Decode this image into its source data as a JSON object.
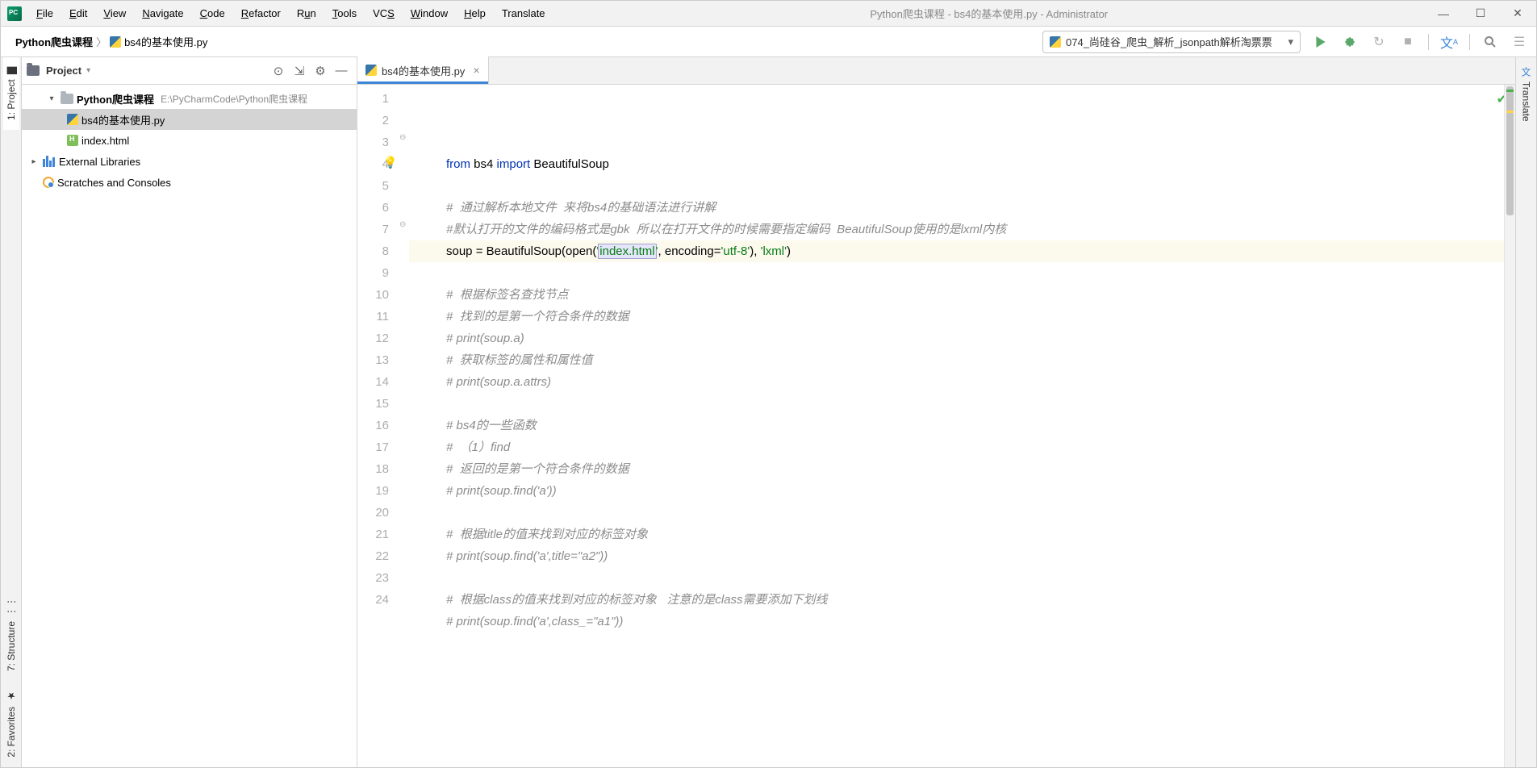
{
  "title": "Python爬虫课程 - bs4的基本使用.py - Administrator",
  "menu": [
    "File",
    "Edit",
    "View",
    "Navigate",
    "Code",
    "Refactor",
    "Run",
    "Tools",
    "VCS",
    "Window",
    "Help",
    "Translate"
  ],
  "breadcrumb": {
    "project": "Python爬虫课程",
    "file": "bs4的基本使用.py"
  },
  "run_config_label": "074_尚硅谷_爬虫_解析_jsonpath解析淘票票",
  "project_panel_title": "Project",
  "tree": {
    "root": {
      "name": "Python爬虫课程",
      "path": "E:\\PyCharmCode\\Python爬虫课程"
    },
    "files": [
      {
        "name": "bs4的基本使用.py",
        "type": "py",
        "selected": true
      },
      {
        "name": "index.html",
        "type": "html",
        "selected": false
      }
    ],
    "external": "External Libraries",
    "scratches": "Scratches and Consoles"
  },
  "left_tabs": {
    "project": "1: Project",
    "structure": "7: Structure",
    "favorites": "2: Favorites"
  },
  "right_tabs": {
    "translate": "Translate"
  },
  "editor_tab": "bs4的基本使用.py",
  "code_lines": [
    {
      "n": 1,
      "type": "code",
      "tokens": [
        [
          "kw",
          "from"
        ],
        [
          "",
          " bs4 "
        ],
        [
          "kw",
          "import"
        ],
        [
          "",
          " BeautifulSoup"
        ]
      ]
    },
    {
      "n": 2,
      "type": "blank"
    },
    {
      "n": 3,
      "type": "cmt",
      "text": "#  通过解析本地文件  来将bs4的基础语法进行讲解"
    },
    {
      "n": 4,
      "type": "cmt",
      "text": "#默认打开的文件的编码格式是gbk  所以在打开文件的时候需要指定编码  BeautifulSoup使用的是lxml内核"
    },
    {
      "n": 5,
      "type": "code",
      "current": true,
      "tokens": [
        [
          "",
          "soup = BeautifulSoup(open("
        ],
        [
          "str",
          "'"
        ],
        [
          "sel",
          "index.html"
        ],
        [
          "str",
          "'"
        ],
        [
          "",
          ", encoding="
        ],
        [
          "str",
          "'utf-8'"
        ],
        [
          "",
          ")"
        ],
        [
          "",
          ", "
        ],
        [
          "str",
          "'lxml'"
        ],
        [
          "",
          ")"
        ]
      ]
    },
    {
      "n": 6,
      "type": "blank"
    },
    {
      "n": 7,
      "type": "cmt",
      "text": "#  根据标签名查找节点"
    },
    {
      "n": 8,
      "type": "cmt",
      "text": "#  找到的是第一个符合条件的数据"
    },
    {
      "n": 9,
      "type": "cmt",
      "text": "# print(soup.a)"
    },
    {
      "n": 10,
      "type": "cmt",
      "text": "#  获取标签的属性和属性值"
    },
    {
      "n": 11,
      "type": "cmt",
      "text": "# print(soup.a.attrs)"
    },
    {
      "n": 12,
      "type": "blank"
    },
    {
      "n": 13,
      "type": "cmt",
      "text": "# bs4的一些函数"
    },
    {
      "n": 14,
      "type": "cmt",
      "text": "#  （1）find"
    },
    {
      "n": 15,
      "type": "cmt",
      "text": "#  返回的是第一个符合条件的数据"
    },
    {
      "n": 16,
      "type": "cmt",
      "text": "# print(soup.find('a'))"
    },
    {
      "n": 17,
      "type": "blank"
    },
    {
      "n": 18,
      "type": "cmt",
      "text": "#  根据title的值来找到对应的标签对象"
    },
    {
      "n": 19,
      "type": "cmt",
      "text": "# print(soup.find('a',title=\"a2\"))"
    },
    {
      "n": 20,
      "type": "blank"
    },
    {
      "n": 21,
      "type": "cmt",
      "text": "#  根据class的值来找到对应的标签对象   注意的是class需要添加下划线"
    },
    {
      "n": 22,
      "type": "cmt",
      "text": "# print(soup.find('a',class_=\"a1\"))"
    },
    {
      "n": 23,
      "type": "blank"
    },
    {
      "n": 24,
      "type": "blank"
    }
  ]
}
